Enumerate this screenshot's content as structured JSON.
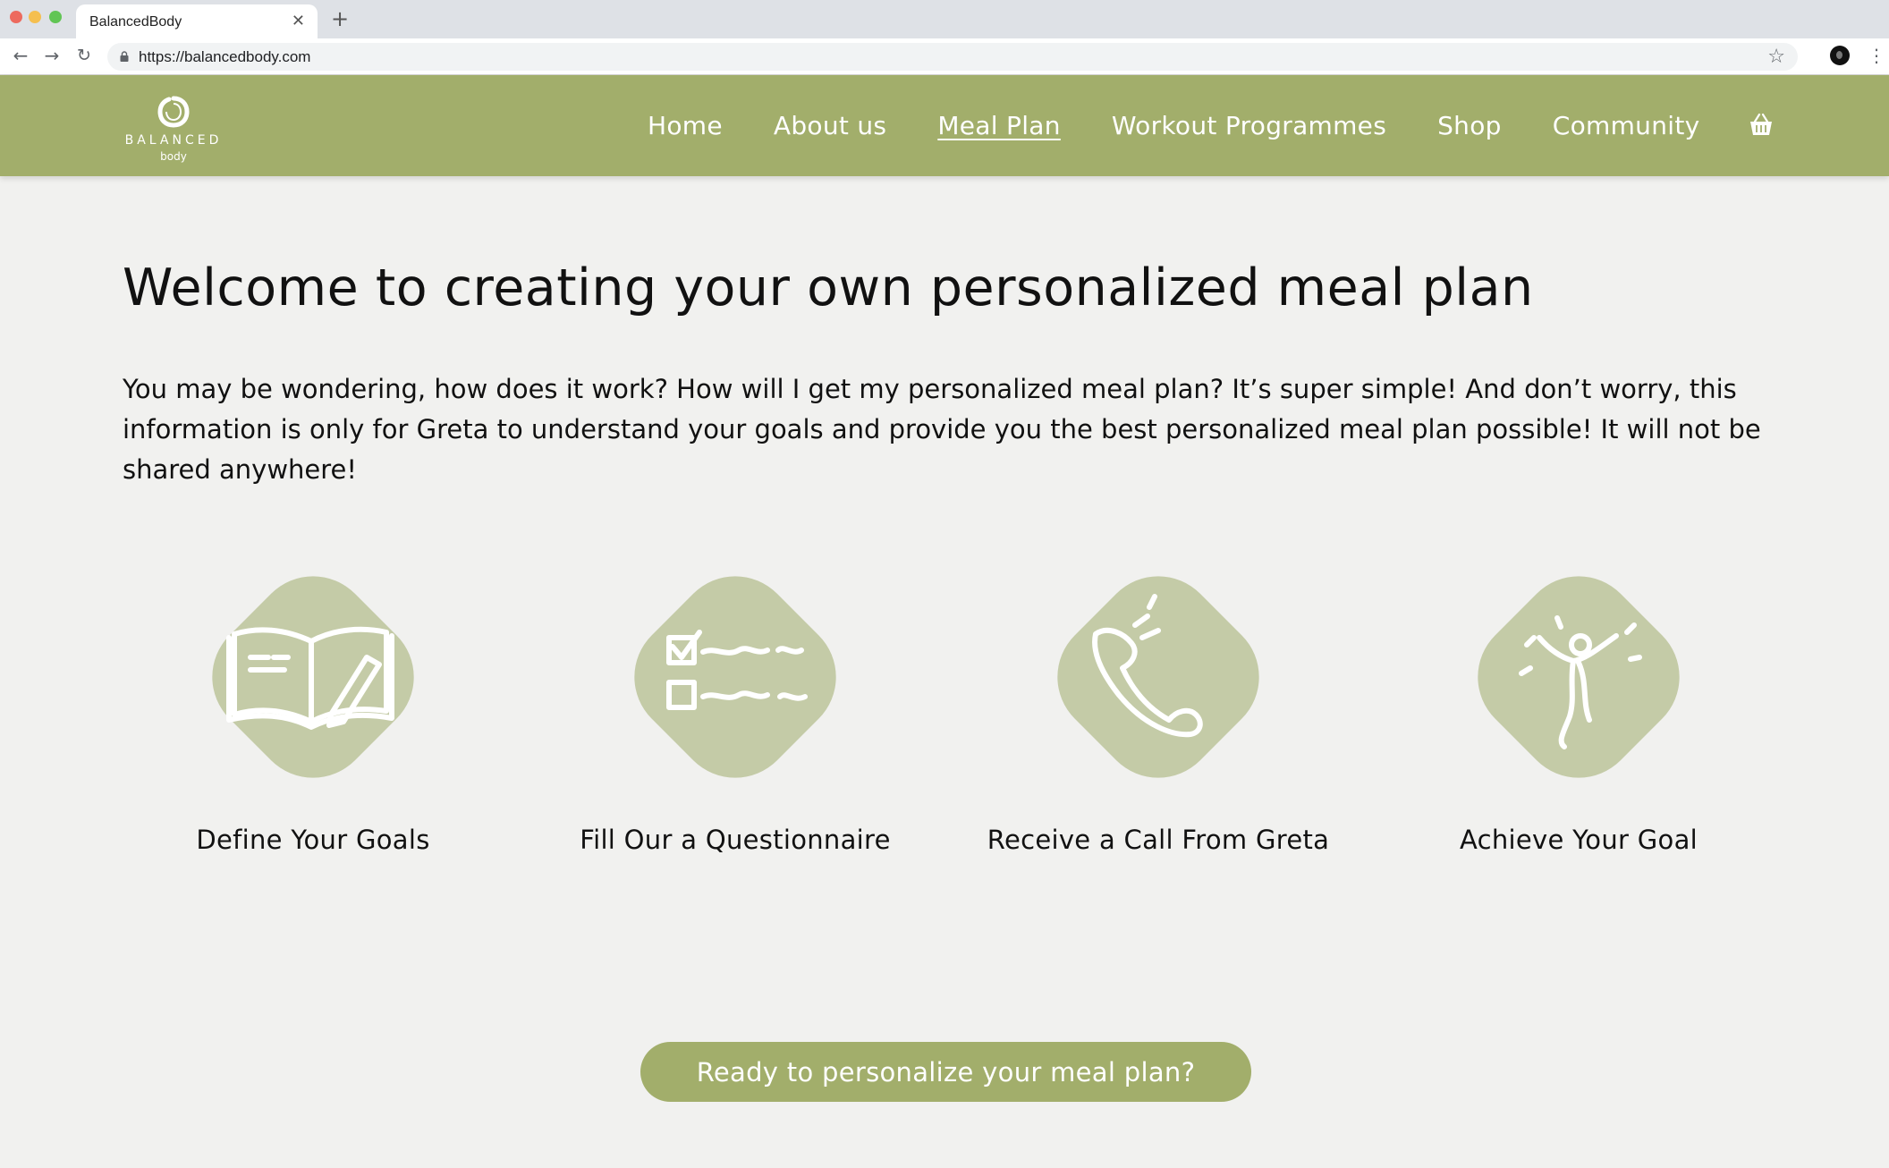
{
  "browser": {
    "tab_title": "BalancedBody",
    "url": "https://balancedbody.com"
  },
  "site": {
    "logo": {
      "word": "BALANCED",
      "sub": "body"
    },
    "nav": [
      "Home",
      "About us",
      "Meal Plan",
      "Workout Programmes",
      "Shop",
      "Community"
    ],
    "active_nav": "Meal Plan"
  },
  "main": {
    "title": "Welcome to creating your own personalized meal plan",
    "intro": "You may be wondering, how does it work? How will I get my personalized meal plan? It’s super simple! And don’t worry, this information is only for Greta to understand your goals and provide you the best personalized meal plan possible! It will not be shared anywhere!",
    "steps": [
      {
        "label": "Define Your Goals",
        "icon": "notebook-pencil-icon"
      },
      {
        "label": "Fill Our a Questionnaire",
        "icon": "checklist-icon"
      },
      {
        "label": "Receive a Call From Greta",
        "icon": "phone-ringing-icon"
      },
      {
        "label": "Achieve Your Goal",
        "icon": "celebrating-person-icon"
      }
    ],
    "cta_label": "Ready to personalize your meal plan?"
  },
  "colors": {
    "brand": "#a2ae6b",
    "badge": "#c4cba7",
    "background": "#f1f1ef"
  }
}
